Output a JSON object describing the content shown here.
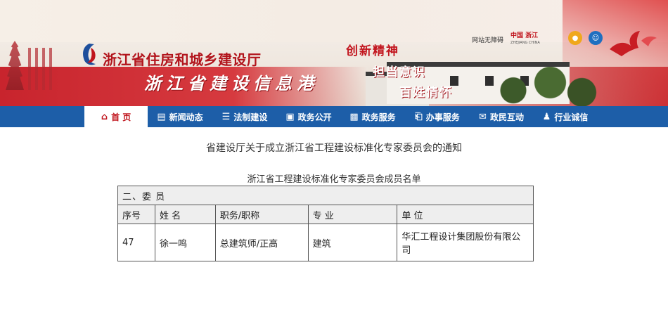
{
  "header": {
    "site_title": "浙江省住房和城乡建设厅",
    "site_subtitle": "浙江省建设信息港",
    "slogans": [
      "创新精神",
      "担当意识",
      "百姓情怀"
    ],
    "top_links": {
      "accessibility": "网站无障碍",
      "portal": "中国 浙江",
      "portal_sub": "ZHEJIANG CHINA"
    },
    "icons": [
      "weibo-icon",
      "wechat-icon"
    ]
  },
  "nav": {
    "items": [
      {
        "label": "首 页",
        "icon": "home-icon",
        "active": true
      },
      {
        "label": "新闻动态",
        "icon": "news-icon",
        "active": false
      },
      {
        "label": "法制建设",
        "icon": "law-icon",
        "active": false
      },
      {
        "label": "政务公开",
        "icon": "open-gov-icon",
        "active": false
      },
      {
        "label": "政务服务",
        "icon": "gov-service-icon",
        "active": false
      },
      {
        "label": "办事服务",
        "icon": "service-icon",
        "active": false
      },
      {
        "label": "政民互动",
        "icon": "interaction-icon",
        "active": false
      },
      {
        "label": "行业诚信",
        "icon": "credit-icon",
        "active": false
      }
    ],
    "colors": {
      "bar": "#1d5ea8",
      "active_text": "#c0141c"
    }
  },
  "main": {
    "doc_title": "省建设厅关于成立浙江省工程建设标准化专家委员会的通知",
    "table_caption": "浙江省工程建设标准化专家委员会成员名单",
    "table": {
      "section": "二、委 员",
      "columns": [
        "序号",
        "姓 名",
        "职务/职称",
        "专 业",
        "单 位"
      ],
      "rows": [
        [
          "47",
          "徐一鸣",
          "总建筑师/正高",
          "建筑",
          "华汇工程设计集团股份有限公司"
        ]
      ]
    }
  }
}
